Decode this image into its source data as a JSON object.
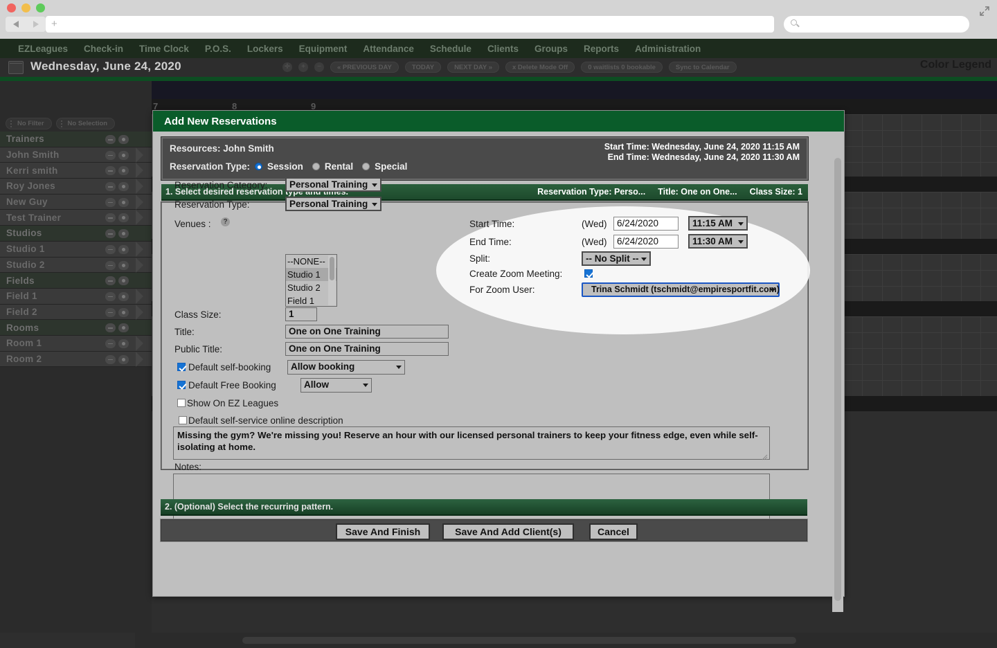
{
  "browser": {
    "url_value": "",
    "url_placeholder": "",
    "search_placeholder": "",
    "new_tab_label": "+"
  },
  "app": {
    "nav_items": [
      "EZLeagues",
      "Check-in",
      "Time Clock",
      "P.O.S.",
      "Lockers",
      "Equipment",
      "Attendance",
      "Schedule",
      "Clients",
      "Groups",
      "Reports",
      "Administration"
    ],
    "date_title": "Wednesday, June 24, 2020",
    "color_legend": "Color Legend",
    "toolbar_buttons": [
      "« PREVIOUS DAY",
      "TODAY",
      "NEXT DAY  »",
      "x Delete Mode Off",
      "0 waitlists 0 bookable",
      "Sync to Calendar"
    ],
    "filters": [
      "No Filter",
      "No Selection"
    ],
    "resources": [
      {
        "label": "Trainers",
        "type": "group"
      },
      {
        "label": "John Smith",
        "type": "child"
      },
      {
        "label": "Kerri smith",
        "type": "child"
      },
      {
        "label": "Roy Jones",
        "type": "child"
      },
      {
        "label": "New Guy",
        "type": "child"
      },
      {
        "label": "Test Trainer",
        "type": "child"
      },
      {
        "label": "Studios",
        "type": "group"
      },
      {
        "label": "Studio 1",
        "type": "child"
      },
      {
        "label": "Studio 2",
        "type": "child"
      },
      {
        "label": "Fields",
        "type": "group"
      },
      {
        "label": "Field 1",
        "type": "child"
      },
      {
        "label": "Field 2",
        "type": "child"
      },
      {
        "label": "Rooms",
        "type": "group"
      },
      {
        "label": "Room 1",
        "type": "child"
      },
      {
        "label": "Room 2",
        "type": "child"
      }
    ],
    "grid_hour_labels": [
      "7",
      "8",
      "9"
    ]
  },
  "modal": {
    "title": "Add New Reservations",
    "resources_line": "Resources: John Smith",
    "start_time_summary": "Start Time: Wednesday, June 24, 2020 11:15 AM",
    "end_time_summary": "End Time: Wednesday, June 24, 2020 11:30 AM",
    "reservation_type_label": "Reservation Type:",
    "reservation_type_options": [
      "Session",
      "Rental",
      "Special"
    ],
    "reservation_type_selected": "Session",
    "step1": {
      "heading": "1. Select desired reservation type and times.",
      "summary_type": "Reservation Type: Perso...",
      "summary_title": "Title: One on One...",
      "summary_class_size": "Class Size: 1"
    },
    "step2": {
      "heading": "2. (Optional) Select the recurring pattern."
    },
    "form": {
      "reservation_category_label": "Reservation Category:",
      "reservation_category_value": "Personal Training",
      "reservation_type_label": "Reservation Type:",
      "reservation_type_value": "Personal Training",
      "venues_label": "Venues :",
      "venues_help_icon": "help-icon",
      "venues_options": [
        "--NONE--",
        "Studio 1",
        "Studio 2",
        "Field 1"
      ],
      "venues_selected": "Studio 1",
      "class_size_label": "Class Size:",
      "class_size_value": "1",
      "title_label": "Title:",
      "title_value": "One on One Training",
      "public_title_label": "Public Title:",
      "public_title_value": "One on One Training",
      "default_self_booking_label": "Default self-booking",
      "default_self_booking_checked": true,
      "default_self_booking_value": "Allow booking",
      "default_free_booking_label": "Default Free Booking",
      "default_free_booking_checked": true,
      "default_free_booking_value": "Allow",
      "show_on_ez_leagues_label": "Show On EZ Leagues",
      "show_on_ez_leagues_checked": false,
      "default_online_description_label": "Default self-service online description",
      "default_online_description_checked": false,
      "description_value": "Missing the gym? We're missing you! Reserve an hour with our licensed personal trainers to keep your fitness edge, even while self-isolating at home.",
      "notes_label": "Notes:",
      "notes_value": ""
    },
    "schedule": {
      "start_time_label": "Start Time:",
      "start_day": "(Wed)",
      "start_date": "6/24/2020",
      "start_time_value": "11:15 AM",
      "end_time_label": "End Time:",
      "end_day": "(Wed)",
      "end_date": "6/24/2020",
      "end_time_value": "11:30 AM",
      "split_label": "Split:",
      "split_value": "-- No Split --",
      "create_zoom_label": "Create Zoom Meeting:",
      "create_zoom_checked": true,
      "zoom_user_label": "For Zoom User:",
      "zoom_user_value": "Trina Schmidt (tschmidt@empiresportfit.com)"
    },
    "buttons": {
      "save_and_finish": "Save And Finish",
      "save_and_add_clients": "Save And Add Client(s)",
      "cancel": "Cancel"
    }
  },
  "colors": {
    "brand_green": "#0a5c2a",
    "nav_green": "#1d2b1d",
    "accent_blue": "#1673d4",
    "panel_gray": "#bfbfbf"
  }
}
